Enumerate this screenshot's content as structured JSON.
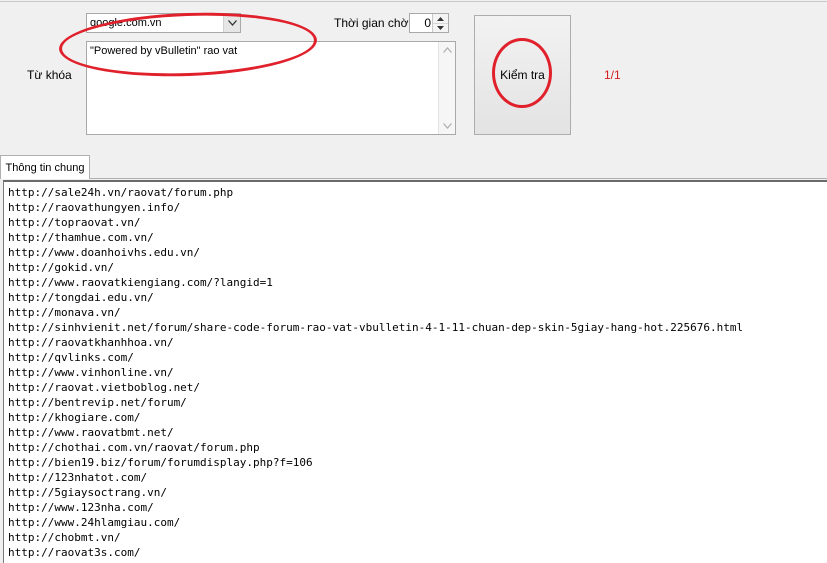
{
  "search": {
    "engine": "google.com.vn",
    "wait_label": "Thời gian chờ",
    "wait_value": "0",
    "keyword_label": "Từ khóa",
    "keyword_value": "\"Powered by vBulletin\" rao vat",
    "check_label": "Kiểm tra",
    "page_counter": "1/1"
  },
  "tabs": [
    {
      "label": "Thông tin chung",
      "active": true
    }
  ],
  "results": [
    "http://sale24h.vn/raovat/forum.php",
    "http://raovathungyen.info/",
    "http://topraovat.vn/",
    "http://thamhue.com.vn/",
    "http://www.doanhoivhs.edu.vn/",
    "http://gokid.vn/",
    "http://www.raovatkiengiang.com/?langid=1",
    "http://tongdai.edu.vn/",
    "http://monava.vn/",
    "http://sinhvienit.net/forum/share-code-forum-rao-vat-vbulletin-4-1-11-chuan-dep-skin-5giay-hang-hot.225676.html",
    "http://raovatkhanhhoa.vn/",
    "http://qvlinks.com/",
    "http://www.vinhonline.vn/",
    "http://raovat.vietboblog.net/",
    "http://bentrevip.net/forum/",
    "http://khogiare.com/",
    "http://www.raovatbmt.net/",
    "http://chothai.com.vn/raovat/forum.php",
    "http://bien19.biz/forum/forumdisplay.php?f=106",
    "http://123nhatot.com/",
    "http://5giaysoctrang.vn/",
    "http://www.123nha.com/",
    "http://www.24hlamgiau.com/",
    "http://chobmt.vn/",
    "http://raovat3s.com/"
  ],
  "colors": {
    "annotation": "#e0202a",
    "counter": "#d42020"
  }
}
